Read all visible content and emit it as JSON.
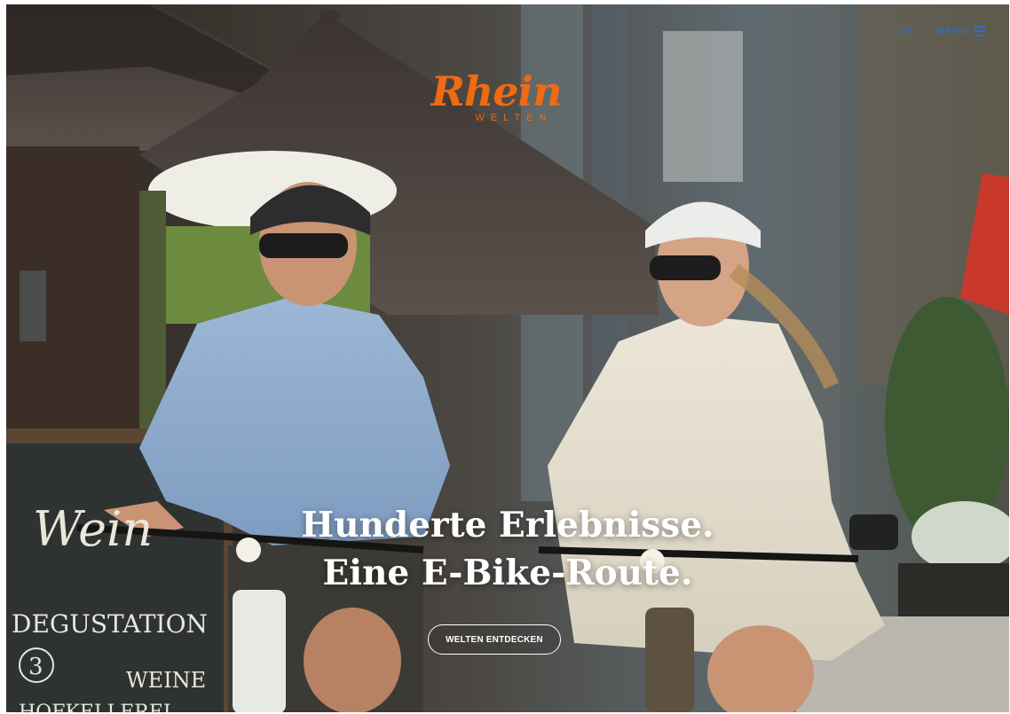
{
  "header": {
    "lang_label": "DE",
    "menu_label": "MENU"
  },
  "logo": {
    "script": "Rhein",
    "sub": "WELTEN"
  },
  "hero": {
    "headline_line1": "Hunderte Erlebnisse.",
    "headline_line2": "Eine E-Bike-Route.",
    "cta_label": "WELTEN ENTDECKEN"
  },
  "chalkboard": {
    "line1": "Wein",
    "line2": "DEGUSTATION",
    "number": "3",
    "line3": "WEINE",
    "line4": "HOFKELLEREI"
  },
  "colors": {
    "brand_orange": "#ef6a12",
    "nav_blue": "#2f6fb7",
    "text_white": "#ffffff"
  },
  "icons": {
    "menu": "hamburger-menu-icon"
  }
}
